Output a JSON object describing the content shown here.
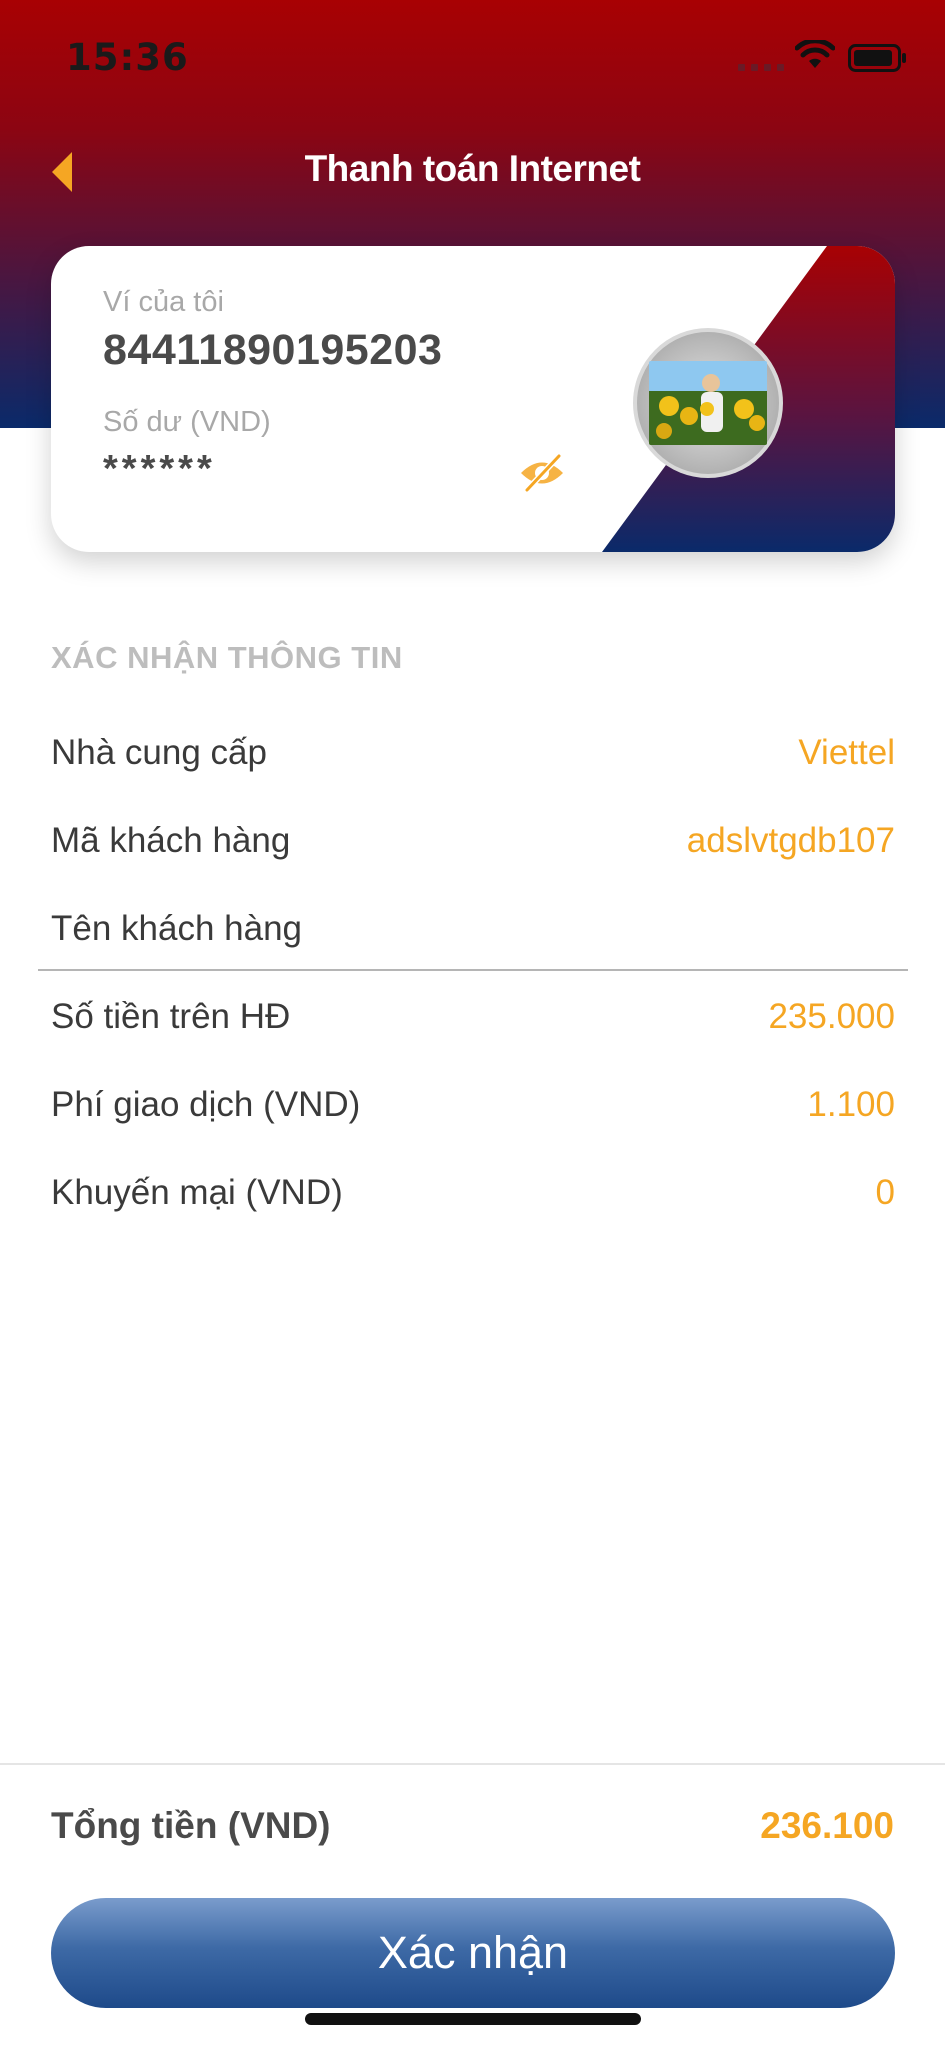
{
  "status_bar": {
    "time": "15:36"
  },
  "nav": {
    "title": "Thanh toán Internet"
  },
  "wallet": {
    "label": "Ví của tôi",
    "number": "84411890195203",
    "balance_label": "Số dư (VND)",
    "balance_value": "******"
  },
  "confirm_info": {
    "section_title": "XÁC NHẬN THÔNG TIN",
    "rows": [
      {
        "label": "Nhà cung cấp",
        "value": "Viettel"
      },
      {
        "label": "Mã khách hàng",
        "value": "adslvtgdb107"
      },
      {
        "label": "Tên khách hàng",
        "value": ""
      },
      {
        "label": "Số tiền trên HĐ",
        "value": "235.000"
      },
      {
        "label": "Phí giao dịch (VND)",
        "value": "1.100"
      },
      {
        "label": "Khuyến mại (VND)",
        "value": "0"
      }
    ]
  },
  "total": {
    "label": "Tổng tiền (VND)",
    "value": "236.100"
  },
  "confirm_button": {
    "label": "Xác nhận"
  },
  "icons": {
    "back": "chevron-left-icon",
    "eye": "eye-slash-icon",
    "wifi": "wifi-icon",
    "battery": "battery-icon"
  },
  "colors": {
    "header_top": "#a80103",
    "header_bottom": "#0a2a6a",
    "accent": "#f5a623",
    "button_blue": "#2e5a9a"
  }
}
